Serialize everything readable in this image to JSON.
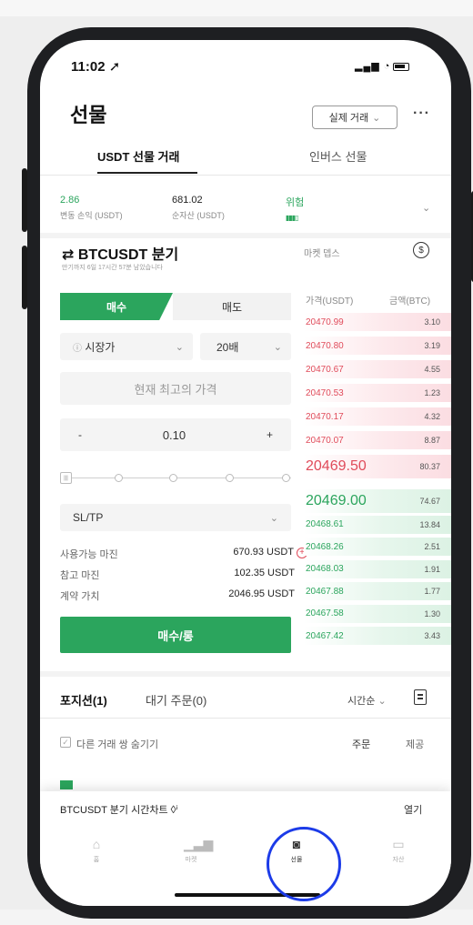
{
  "status": {
    "time": "11:02"
  },
  "header": {
    "title": "선물",
    "mode_button": "실제 거래",
    "more": "···"
  },
  "tabs": {
    "active": "USDT 선물 거래",
    "inactive": "인버스 선물"
  },
  "stats": [
    {
      "value": "2.86",
      "label": "변동 손익 (USDT)"
    },
    {
      "value": "681.02",
      "label": "순자산 (USDT)"
    },
    {
      "value": "위험",
      "label": ""
    }
  ],
  "contract": {
    "pair": "BTCUSDT 분기",
    "subtitle": "만기까지 6일 17시간 57분 남았습니다",
    "market_label": "마켓 뎁스"
  },
  "order_form": {
    "buy_tab": "매수",
    "sell_tab": "매도",
    "order_type": "시장가",
    "leverage": "20배",
    "price_placeholder": "현재 최고의 가격",
    "qty_minus": "-",
    "qty_value": "0.10",
    "qty_plus": "+",
    "sltp": "SL/TP",
    "available_margin_label": "사용가능 마진",
    "available_margin_value": "670.93 USDT",
    "ref_margin_label": "참고 마진",
    "ref_margin_value": "102.35 USDT",
    "contract_value_label": "계약 가치",
    "contract_value_value": "2046.95 USDT",
    "submit": "매수/롱"
  },
  "orderbook": {
    "price_header": "가격(USDT)",
    "amount_header": "금액(BTC)",
    "asks": [
      {
        "price": "20470.99",
        "amount": "3.10"
      },
      {
        "price": "20470.80",
        "amount": "3.19"
      },
      {
        "price": "20470.67",
        "amount": "4.55"
      },
      {
        "price": "20470.53",
        "amount": "1.23"
      },
      {
        "price": "20470.17",
        "amount": "4.32"
      },
      {
        "price": "20470.07",
        "amount": "8.87"
      },
      {
        "price": "20469.50",
        "amount": "80.37"
      }
    ],
    "bids": [
      {
        "price": "20469.00",
        "amount": "74.67"
      },
      {
        "price": "20468.61",
        "amount": "13.84"
      },
      {
        "price": "20468.26",
        "amount": "2.51"
      },
      {
        "price": "20468.03",
        "amount": "1.91"
      },
      {
        "price": "20467.88",
        "amount": "1.77"
      },
      {
        "price": "20467.58",
        "amount": "1.30"
      },
      {
        "price": "20467.42",
        "amount": "3.43"
      }
    ]
  },
  "positions": {
    "tab_positions": "포지션(1)",
    "tab_pending": "대기 주문(0)",
    "sort": "시간순",
    "hide_label": "다른 거래 쌍 숨기기",
    "col_order": "주문",
    "col_close": "제공"
  },
  "bottom_bar": {
    "chart_label": "BTCUSDT 분기  시간차트",
    "open_label": "열기",
    "nav": [
      {
        "icon": "home-icon",
        "label": "홈"
      },
      {
        "icon": "market-icon",
        "label": "마켓"
      },
      {
        "icon": "futures-icon",
        "label": "선물"
      },
      {
        "icon": "wallet-icon",
        "label": "자산"
      }
    ]
  },
  "colors": {
    "green": "#2ba55d",
    "red": "#e04b5a",
    "highlight": "#1c3be8"
  }
}
